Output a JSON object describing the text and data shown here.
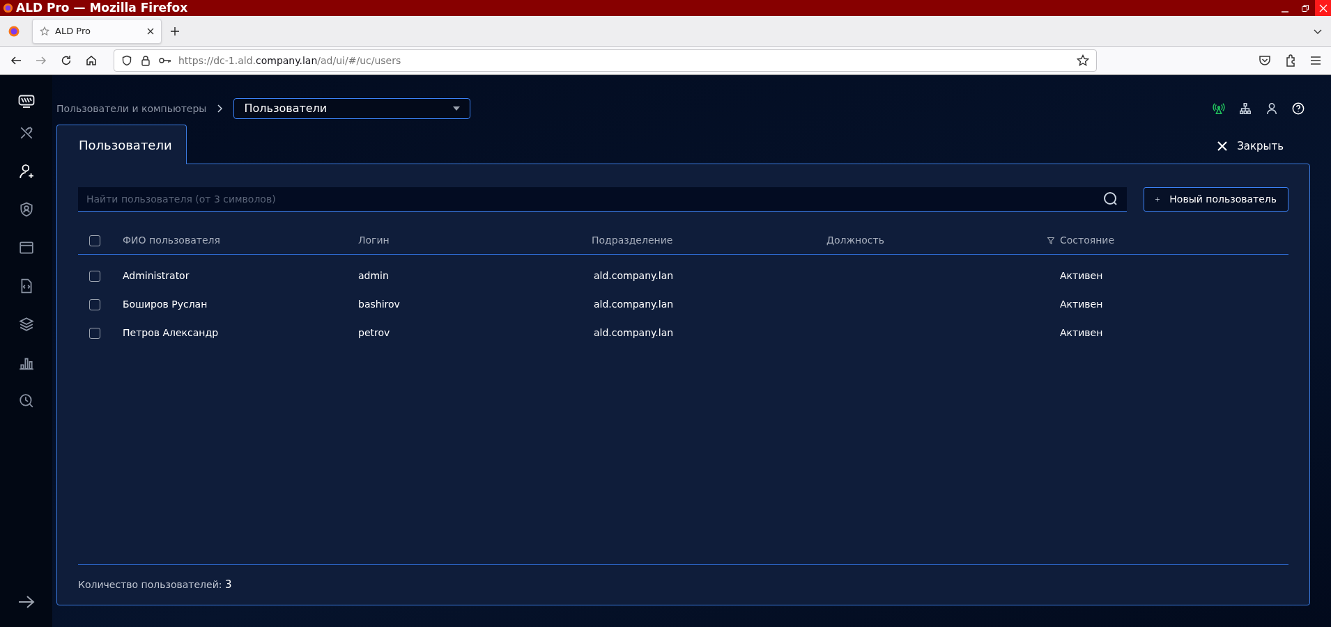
{
  "window": {
    "title": "ALD Pro — Mozilla Firefox"
  },
  "browser": {
    "tabs": [
      {
        "label": "ALD Pro",
        "selected": true
      }
    ],
    "url": {
      "prefix": "https://dc-1.ald.",
      "domain": "company.lan",
      "path": "/ad/ui/#/uc/users"
    }
  },
  "sidebar": {
    "items": [
      {
        "selected": false
      },
      {
        "selected": true
      },
      {
        "selected": false
      },
      {
        "selected": false
      },
      {
        "selected": false
      },
      {
        "selected": false
      },
      {
        "selected": false
      },
      {
        "selected": false
      }
    ]
  },
  "breadcrumb": {
    "parent": "Пользователи и компьютеры",
    "dropdown": "Пользователи"
  },
  "header_icons": [
    {
      "color": "#22c55e"
    },
    {
      "color": "#cbd5e1"
    },
    {
      "color": "#cbd5e1"
    },
    {
      "color": "#ffffff"
    }
  ],
  "tabs": [
    {
      "label": "Пользователи",
      "selected": true
    }
  ],
  "close_button": "Закрыть",
  "search": {
    "placeholder": "Найти пользователя (от 3 символов)"
  },
  "new_button": "Новый пользователь",
  "table": {
    "header_checked": false,
    "columns": [
      {
        "label": "ФИО пользователя",
        "filter": false
      },
      {
        "label": "Логин",
        "filter": false
      },
      {
        "label": "Подразделение",
        "filter": false
      },
      {
        "label": "Должность",
        "filter": false
      },
      {
        "label": "Состояние",
        "filter": true
      }
    ],
    "rows": [
      {
        "checked": false,
        "cells": [
          "Administrator",
          "admin",
          "ald.company.lan",
          "",
          "Активен"
        ]
      },
      {
        "checked": false,
        "cells": [
          "Боширов Руслан",
          "bashirov",
          "ald.company.lan",
          "",
          "Активен"
        ]
      },
      {
        "checked": false,
        "cells": [
          "Петров Александр",
          "petrov",
          "ald.company.lan",
          "",
          "Активен"
        ]
      }
    ]
  },
  "footer": {
    "label": "Количество пользователей:",
    "count": "3"
  }
}
